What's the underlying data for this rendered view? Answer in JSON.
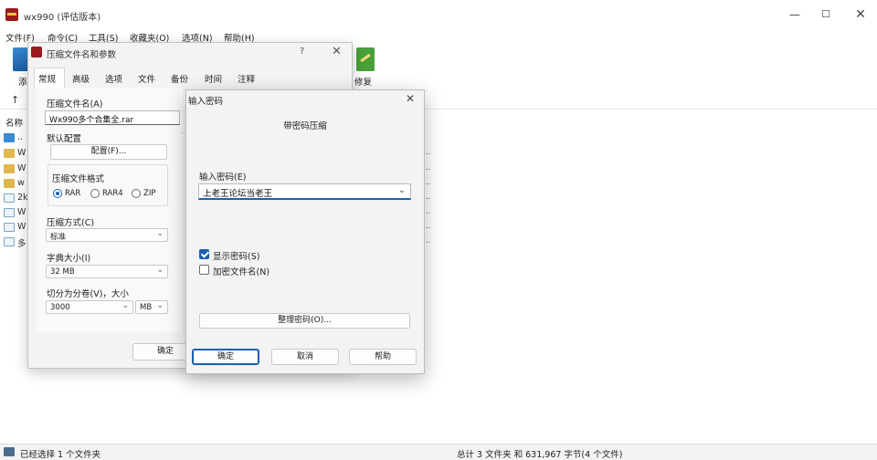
{
  "window": {
    "title": "wx990 (评估版本)",
    "minimize": "—",
    "maximize": "☐",
    "close": "✕"
  },
  "menu": [
    "文件(F)",
    "命令(C)",
    "工具(S)",
    "收藏夹(O)",
    "选项(N)",
    "帮助(H)"
  ],
  "toolbar": {
    "add_label": "添",
    "repair_label": "修复"
  },
  "file_list": {
    "column_name": "名称",
    "rows": [
      "..",
      "W",
      "W",
      "w",
      "2k",
      "W",
      "W",
      "多"
    ],
    "ellipsis": "..."
  },
  "status": {
    "left": "已经选择 1 个文件夹",
    "right": "总计 3 文件夹 和 631,967 字节(4 个文件)"
  },
  "archive_dialog": {
    "title": "压缩文件名和参数",
    "help": "?",
    "close": "✕",
    "tabs": [
      "常规",
      "高级",
      "选项",
      "文件",
      "备份",
      "时间",
      "注释"
    ],
    "name_label": "压缩文件名(A)",
    "name_value": "Wx990多个合集全.rar",
    "profile_label": "默认配置",
    "profiles_button": "配置(F)...",
    "format_label": "压缩文件格式",
    "formats": [
      "RAR",
      "RAR4",
      "ZIP"
    ],
    "selected_format": "RAR",
    "method_label": "压缩方式(C)",
    "method_value": "标准",
    "dict_label": "字典大小(I)",
    "dict_value": "32 MB",
    "split_label": "切分为分卷(V)，大小",
    "split_value": "3000",
    "split_unit": "MB",
    "ok": "确定"
  },
  "password_dialog": {
    "title": "输入密码",
    "close": "✕",
    "heading": "带密码压缩",
    "password_label": "输入密码(E)",
    "password_value": "上老王论坛当老王",
    "show_password": "显示密码(S)",
    "show_password_checked": true,
    "encrypt_names": "加密文件名(N)",
    "encrypt_names_checked": false,
    "organize_button": "整理密码(O)...",
    "ok": "确定",
    "cancel": "取消",
    "help": "帮助"
  },
  "icons": {
    "up": "↑",
    "chevron_down": "⌄"
  },
  "colors": {
    "accent": "#1a5fb4",
    "app_icon": "#9b1b1b",
    "folder": "#e2b64e"
  }
}
